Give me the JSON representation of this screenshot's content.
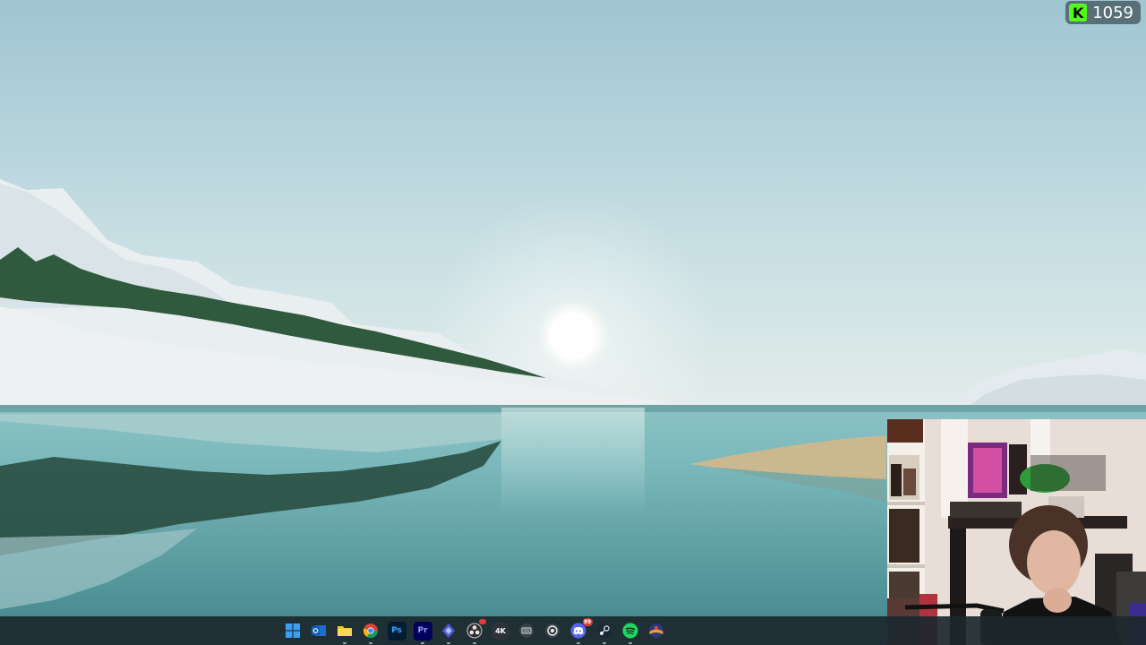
{
  "overlay": {
    "viewer_count": "1059",
    "logo_letter": "K",
    "brand_color": "#53fc18"
  },
  "taskbar": {
    "items": [
      {
        "name": "start-menu",
        "icon": "windows-logo-icon"
      },
      {
        "name": "outlook",
        "icon": "outlook-icon"
      },
      {
        "name": "file-explorer",
        "icon": "folder-icon"
      },
      {
        "name": "chrome",
        "icon": "chrome-icon"
      },
      {
        "name": "photoshop",
        "icon": "photoshop-icon",
        "label": "Ps"
      },
      {
        "name": "premiere-pro",
        "icon": "premiere-icon",
        "label": "Pr"
      },
      {
        "name": "app-diamond",
        "icon": "diamond-icon"
      },
      {
        "name": "obs",
        "icon": "obs-icon"
      },
      {
        "name": "4k-downloader",
        "icon": "4k-icon",
        "label": "4K"
      },
      {
        "name": "keyboard-app",
        "icon": "keyboard-icon"
      },
      {
        "name": "circle-app",
        "icon": "circle-app-icon"
      },
      {
        "name": "discord",
        "icon": "discord-icon",
        "badge": "99"
      },
      {
        "name": "steam",
        "icon": "steam-icon"
      },
      {
        "name": "spotify",
        "icon": "spotify-icon"
      },
      {
        "name": "app-last",
        "icon": "globe-app-icon"
      }
    ]
  },
  "colors": {
    "taskbar_bg": "#1c282e",
    "sky": "#a9cbd6",
    "water": "#5fa3a8"
  }
}
